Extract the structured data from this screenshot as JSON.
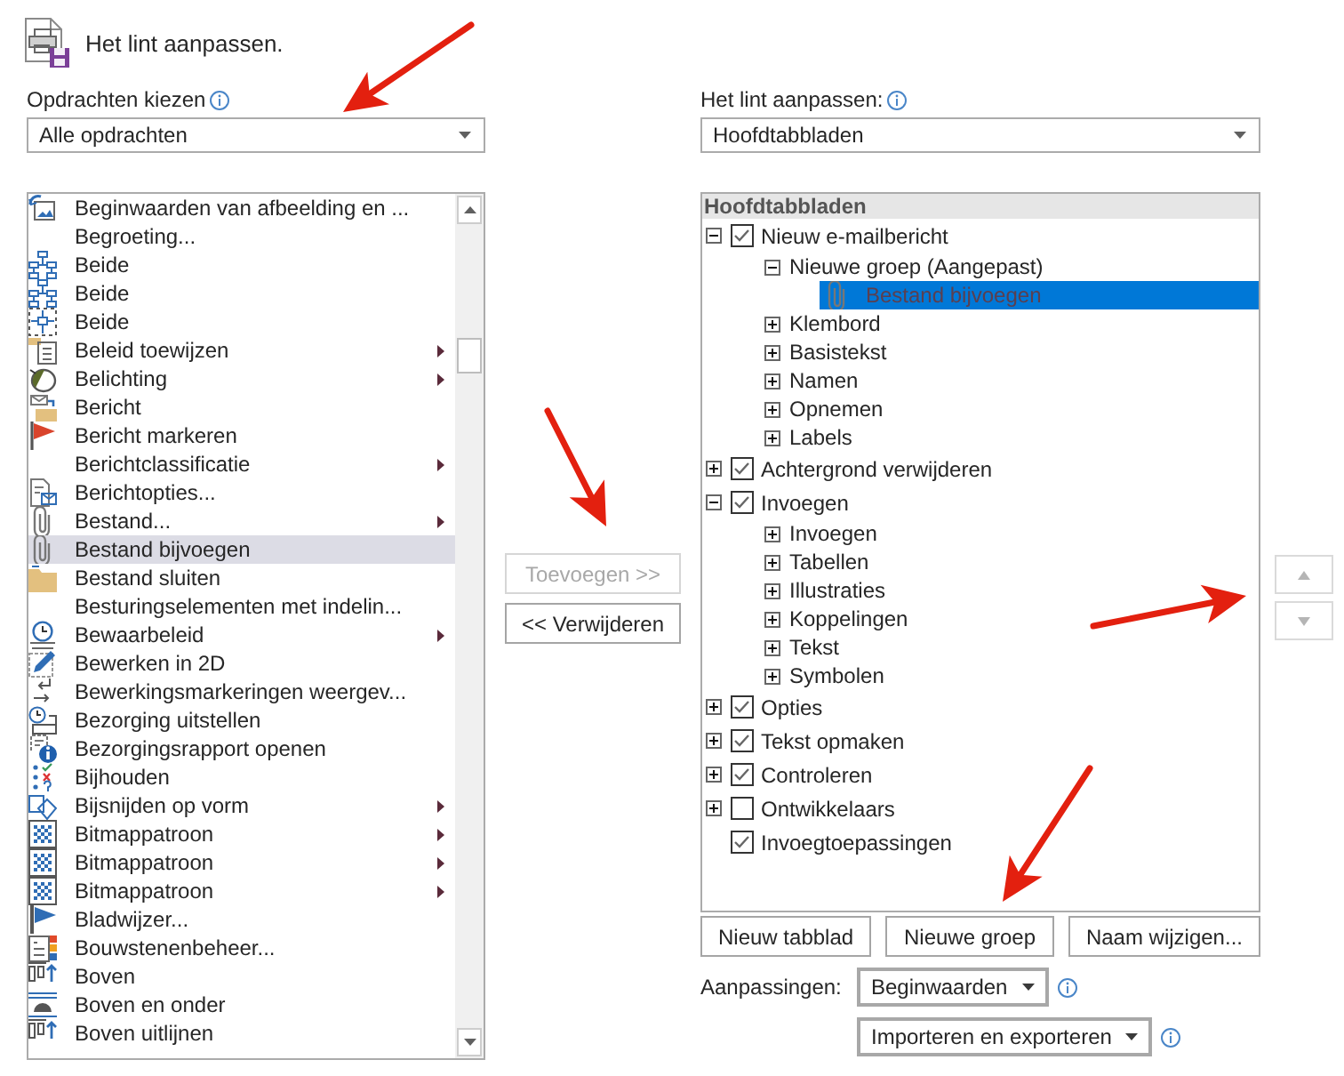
{
  "header": {
    "title": "Het lint aanpassen."
  },
  "commands": {
    "label": "Opdrachten kiezen",
    "dropdown": {
      "value": "Alle opdrachten"
    },
    "items": [
      {
        "label": "Beginwaarden van afbeelding en ...",
        "submenu": false,
        "selected": false
      },
      {
        "label": "Begroeting...",
        "submenu": false,
        "selected": false
      },
      {
        "label": "Beide",
        "submenu": false,
        "selected": false
      },
      {
        "label": "Beide",
        "submenu": false,
        "selected": false
      },
      {
        "label": "Beide",
        "submenu": false,
        "selected": false
      },
      {
        "label": "Beleid toewijzen",
        "submenu": true,
        "selected": false
      },
      {
        "label": "Belichting",
        "submenu": true,
        "selected": false
      },
      {
        "label": "Bericht",
        "submenu": false,
        "selected": false
      },
      {
        "label": "Bericht markeren",
        "submenu": false,
        "selected": false
      },
      {
        "label": "Berichtclassificatie",
        "submenu": true,
        "selected": false
      },
      {
        "label": "Berichtopties...",
        "submenu": false,
        "selected": false
      },
      {
        "label": "Bestand...",
        "submenu": true,
        "selected": false
      },
      {
        "label": "Bestand bijvoegen",
        "submenu": false,
        "selected": true
      },
      {
        "label": "Bestand sluiten",
        "submenu": false,
        "selected": false
      },
      {
        "label": "Besturingselementen met indelin...",
        "submenu": false,
        "selected": false
      },
      {
        "label": "Bewaarbeleid",
        "submenu": true,
        "selected": false
      },
      {
        "label": "Bewerken in 2D",
        "submenu": false,
        "selected": false
      },
      {
        "label": "Bewerkingsmarkeringen weergev...",
        "submenu": false,
        "selected": false
      },
      {
        "label": "Bezorging uitstellen",
        "submenu": false,
        "selected": false
      },
      {
        "label": "Bezorgingsrapport openen",
        "submenu": false,
        "selected": false
      },
      {
        "label": "Bijhouden",
        "submenu": false,
        "selected": false
      },
      {
        "label": "Bijsnijden op vorm",
        "submenu": true,
        "selected": false
      },
      {
        "label": "Bitmappatroon",
        "submenu": true,
        "selected": false
      },
      {
        "label": "Bitmappatroon",
        "submenu": true,
        "selected": false
      },
      {
        "label": "Bitmappatroon",
        "submenu": true,
        "selected": false
      },
      {
        "label": "Bladwijzer...",
        "submenu": false,
        "selected": false
      },
      {
        "label": "Bouwstenenbeheer...",
        "submenu": false,
        "selected": false
      },
      {
        "label": "Boven",
        "submenu": false,
        "selected": false
      },
      {
        "label": "Boven en onder",
        "submenu": false,
        "selected": false
      },
      {
        "label": "Boven uitlijnen",
        "submenu": false,
        "selected": false
      }
    ]
  },
  "middle_buttons": [
    {
      "label": "Toevoegen >>",
      "disabled": true
    },
    {
      "label": "<< Verwijderen",
      "disabled": false
    }
  ],
  "ribbon": {
    "label": "Het lint aanpassen:",
    "dropdown": {
      "value": "Hoofdtabbladen"
    },
    "tree": {
      "header": "Hoofdtabbladen",
      "items": [
        {
          "label": "Nieuw e-mailbericht",
          "expanded": true,
          "checked": true,
          "selected": false,
          "children": [
            {
              "label": "Nieuwe groep (Aangepast)",
              "expanded": true,
              "selected": false,
              "children": [
                {
                  "label": "Bestand bijvoegen",
                  "selected": true
                }
              ]
            },
            {
              "label": "Klembord",
              "expanded": false,
              "selected": false
            },
            {
              "label": "Basistekst",
              "expanded": false,
              "selected": false
            },
            {
              "label": "Namen",
              "expanded": false,
              "selected": false
            },
            {
              "label": "Opnemen",
              "expanded": false,
              "selected": false
            },
            {
              "label": "Labels",
              "expanded": false,
              "selected": false
            }
          ]
        },
        {
          "label": "Achtergrond verwijderen",
          "expanded": false,
          "checked": true,
          "selected": false
        },
        {
          "label": "Invoegen",
          "expanded": true,
          "checked": true,
          "selected": false,
          "children": [
            {
              "label": "Invoegen",
              "expanded": false,
              "selected": false
            },
            {
              "label": "Tabellen",
              "expanded": false,
              "selected": false
            },
            {
              "label": "Illustraties",
              "expanded": false,
              "selected": false
            },
            {
              "label": "Koppelingen",
              "expanded": false,
              "selected": false
            },
            {
              "label": "Tekst",
              "expanded": false,
              "selected": false
            },
            {
              "label": "Symbolen",
              "expanded": false,
              "selected": false
            }
          ]
        },
        {
          "label": "Opties",
          "expanded": false,
          "checked": true,
          "selected": false
        },
        {
          "label": "Tekst opmaken",
          "expanded": false,
          "checked": true,
          "selected": false
        },
        {
          "label": "Controleren",
          "expanded": false,
          "checked": true,
          "selected": false
        },
        {
          "label": "Ontwikkelaars",
          "expanded": false,
          "checked": false,
          "selected": false
        },
        {
          "label": "Invoegtoepassingen",
          "checked": true,
          "selected": false
        }
      ]
    },
    "buttons": [
      {
        "label": "Nieuw tabblad"
      },
      {
        "label": "Nieuwe groep"
      },
      {
        "label": "Naam wijzigen..."
      }
    ],
    "customizations": {
      "label": "Aanpassingen:",
      "menus": [
        {
          "label": "Beginwaarden"
        },
        {
          "label": "Importeren en exporteren"
        }
      ]
    }
  },
  "move_buttons": [
    {
      "kind": "up",
      "disabled": true
    },
    {
      "kind": "down",
      "disabled": true
    }
  ],
  "annotations": [
    {
      "kind": "arrow"
    },
    {
      "kind": "arrow"
    },
    {
      "kind": "arrow"
    },
    {
      "kind": "arrow"
    }
  ]
}
